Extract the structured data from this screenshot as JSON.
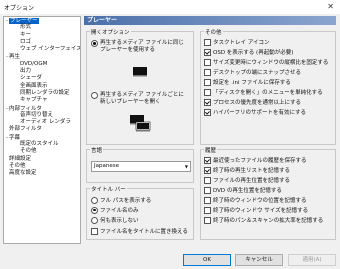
{
  "window": {
    "title": "オプション",
    "close": "✕"
  },
  "tree": [
    {
      "label": "プレーヤー",
      "level": 0,
      "toggle": "minus",
      "selected": true
    },
    {
      "label": "形式",
      "level": 1
    },
    {
      "label": "キー",
      "level": 1
    },
    {
      "label": "ロゴ",
      "level": 1
    },
    {
      "label": "ウェブ インターフェイス",
      "level": 1
    },
    {
      "label": "再生",
      "level": 0,
      "toggle": "minus"
    },
    {
      "label": "DVD/OGM",
      "level": 1
    },
    {
      "label": "出力",
      "level": 1
    },
    {
      "label": "シェーダ",
      "level": 1
    },
    {
      "label": "全画面表示",
      "level": 1
    },
    {
      "label": "同期レンダラの設定",
      "level": 1
    },
    {
      "label": "キャプチャ",
      "level": 1
    },
    {
      "label": "内部フィルタ",
      "level": 0,
      "toggle": "minus"
    },
    {
      "label": "音声切り替え",
      "level": 1
    },
    {
      "label": "オーディオ レンダラ",
      "level": 1
    },
    {
      "label": "外部フィルタ",
      "level": 0
    },
    {
      "label": "字幕",
      "level": 0,
      "toggle": "minus"
    },
    {
      "label": "既定のスタイル",
      "level": 1
    },
    {
      "label": "その他",
      "level": 1
    },
    {
      "label": "詳細設定",
      "level": 0
    },
    {
      "label": "その他",
      "level": 0
    },
    {
      "label": "高度な設定",
      "level": 0
    }
  ],
  "panel": {
    "header": "プレーヤー",
    "open_options": {
      "title": "開くオプション",
      "radio1": "再生するメディア ファイルに同じプレーヤーを使用する",
      "radio1_lines": [
        "再生するメディア ファイルに同じ",
        "プレーヤーを使用する"
      ],
      "radio1_checked": true,
      "radio2": "再生するメディア ファイルごとに新しいプレーヤーを開く",
      "radio2_lines": [
        "再生するメディア ファイルごとに",
        "新しいプレーヤーを開く"
      ],
      "radio2_checked": false
    },
    "language": {
      "title": "言語",
      "value": "Japanese"
    },
    "titlebar": {
      "title": "タイトル バー",
      "opt1": "フル パスを表示する",
      "opt1_checked": false,
      "opt2": "ファイル名のみ",
      "opt2_checked": true,
      "opt3": "何も表示しない",
      "opt3_checked": false,
      "check": "ファイル名をタイトルに置き換える",
      "check_checked": false
    },
    "other": {
      "title": "その他",
      "items": [
        {
          "label": "タスクトレイ アイコン",
          "checked": false
        },
        {
          "label": "OSD を表示する (再起動が必要)",
          "checked": true
        },
        {
          "label": "サイズ変更時にウィンドウの縦横比を固定する",
          "checked": false
        },
        {
          "label": "デスクトップの端にスナップさせる",
          "checked": false
        },
        {
          "label": "設定を .ini ファイルに保存する",
          "checked": false
        },
        {
          "label": "「ディスクを開く」のメニューを単純化する",
          "checked": false
        },
        {
          "label": "プロセスの優先度を通常以上にする",
          "checked": true
        },
        {
          "label": "ハイパーフリのサポートを有効にする",
          "checked": true
        }
      ]
    },
    "history": {
      "title": "履歴",
      "items": [
        {
          "label": "最近使ったファイルの履歴を保存する",
          "checked": true
        },
        {
          "label": "終了時の再生リストを記憶する",
          "checked": true
        },
        {
          "label": "ファイルの再生位置を記憶する",
          "checked": false
        },
        {
          "label": "DVD の再生位置を記憶する",
          "checked": false
        },
        {
          "label": "終了時のウィンドウの位置を記憶する",
          "checked": false
        },
        {
          "label": "終了時のウィンドウ サイズを記憶する",
          "checked": false
        },
        {
          "label": "終了時のパン＆スキャンの拡大率を記憶する",
          "checked": false
        }
      ]
    }
  },
  "buttons": {
    "ok": "OK",
    "cancel": "キャンセル",
    "apply": "適用(A)"
  },
  "colors": {
    "header_start": "#4b6fa8",
    "header_end": "#8aa6d0",
    "selection": "#0a64c8",
    "default_button_border": "#0078d7"
  }
}
